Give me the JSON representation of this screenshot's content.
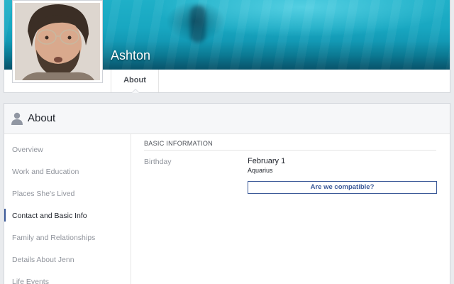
{
  "profile": {
    "name": "Ashton",
    "tabs": [
      {
        "label": "About"
      }
    ]
  },
  "about": {
    "title": "About",
    "nav": [
      {
        "label": "Overview"
      },
      {
        "label": "Work and Education"
      },
      {
        "label": "Places She's Lived"
      },
      {
        "label": "Contact and Basic Info",
        "active": true
      },
      {
        "label": "Family and Relationships"
      },
      {
        "label": "Details About Jenn"
      },
      {
        "label": "Life Events"
      }
    ],
    "basic_info": {
      "heading": "BASIC INFORMATION",
      "birthday_label": "Birthday",
      "birthday_value": "February 1",
      "zodiac": "Aquarius",
      "compat_button": "Are we compatible?"
    }
  },
  "colors": {
    "accent": "#3b5998",
    "cover": "#18a7c1"
  }
}
